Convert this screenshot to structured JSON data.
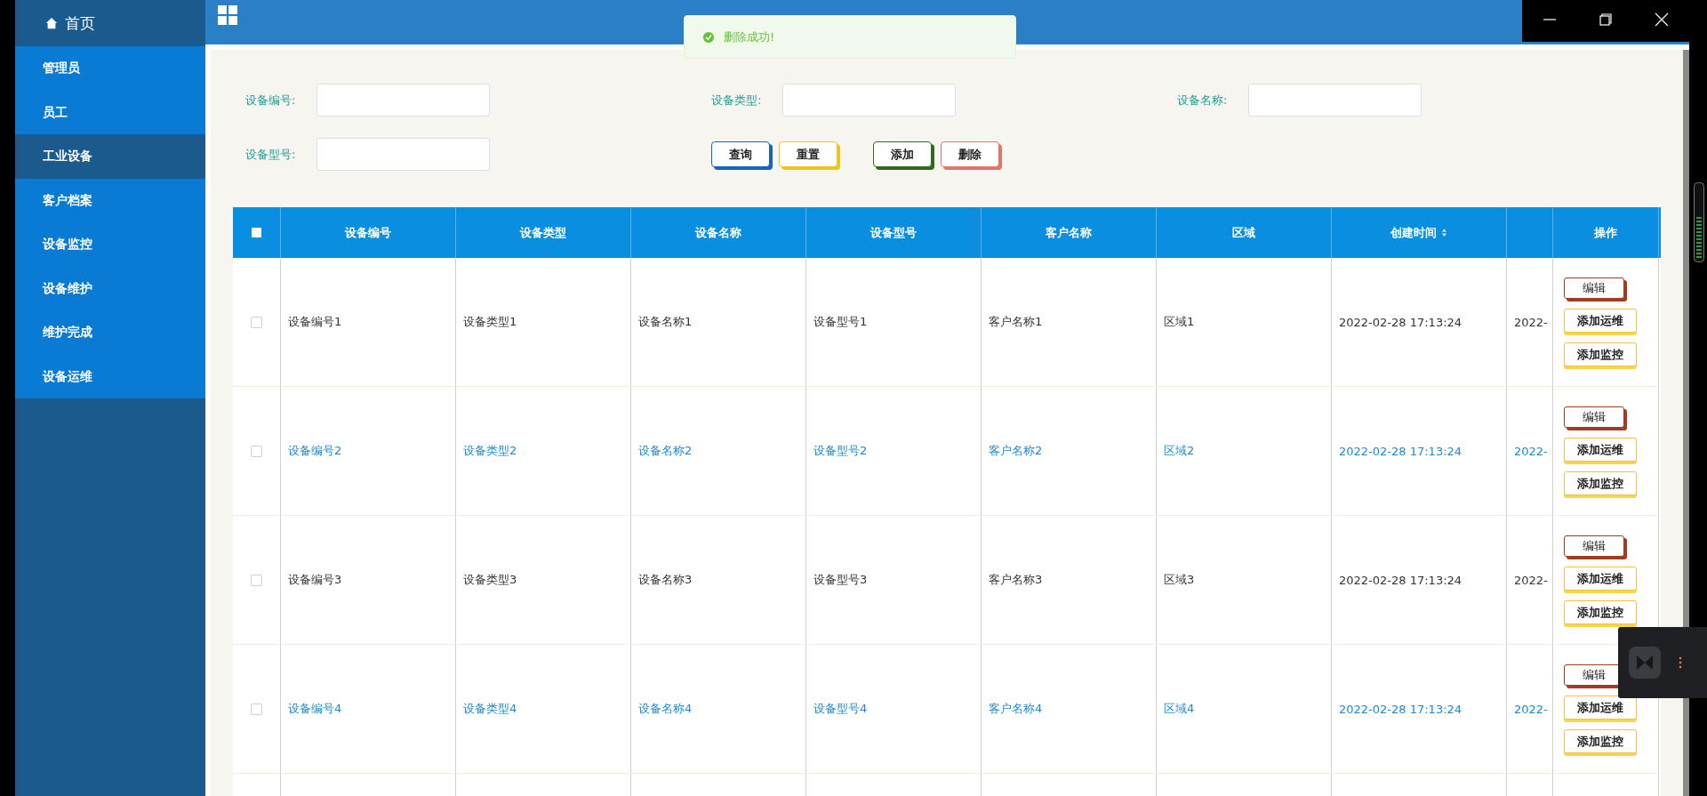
{
  "sidebar": {
    "home": "首页",
    "items": [
      {
        "label": "管理员",
        "selected": false
      },
      {
        "label": "员工",
        "selected": false
      },
      {
        "label": "工业设备",
        "selected": true
      },
      {
        "label": "客户档案",
        "selected": false
      },
      {
        "label": "设备监控",
        "selected": false
      },
      {
        "label": "设备维护",
        "selected": false
      },
      {
        "label": "维护完成",
        "selected": false
      },
      {
        "label": "设备运维",
        "selected": false
      }
    ]
  },
  "toast": {
    "message": "删除成功!"
  },
  "search_form": {
    "fields": [
      {
        "label": "设备编号:"
      },
      {
        "label": "设备类型:"
      },
      {
        "label": "设备名称:"
      },
      {
        "label": "设备型号:"
      }
    ],
    "buttons": [
      {
        "label": "查询",
        "color": "#1565c0"
      },
      {
        "label": "重置",
        "color": "#f0c419"
      },
      {
        "label": "添加",
        "color": "#2e6b1f"
      },
      {
        "label": "删除",
        "color": "#e57368"
      }
    ]
  },
  "table": {
    "select_all_checked": false,
    "columns": [
      {
        "label": "设备编号",
        "sortable": false
      },
      {
        "label": "设备类型",
        "sortable": false
      },
      {
        "label": "设备名称",
        "sortable": false
      },
      {
        "label": "设备型号",
        "sortable": false
      },
      {
        "label": "客户名称",
        "sortable": false
      },
      {
        "label": "区域",
        "sortable": false
      },
      {
        "label": "创建时间",
        "sortable": true
      },
      {
        "sortable": false
      },
      {
        "label": "操作",
        "sortable": false
      }
    ],
    "rows": [
      {
        "kind": "plain",
        "checked": false,
        "cells": [
          "设备编号1",
          "设备类型1",
          "设备名称1",
          "设备型号1",
          "客户名称1",
          "区域1",
          "2022-02-28 17:13:24",
          "2022-"
        ],
        "actions": [
          "编辑",
          "添加运维",
          "添加监控"
        ]
      },
      {
        "kind": "link",
        "checked": false,
        "cells": [
          "设备编号2",
          "设备类型2",
          "设备名称2",
          "设备型号2",
          "客户名称2",
          "区域2",
          "2022-02-28 17:13:24",
          "2022-"
        ],
        "actions": [
          "编辑",
          "添加运维",
          "添加监控"
        ]
      },
      {
        "kind": "plain",
        "checked": false,
        "cells": [
          "设备编号3",
          "设备类型3",
          "设备名称3",
          "设备型号3",
          "客户名称3",
          "区域3",
          "2022-02-28 17:13:24",
          "2022-"
        ],
        "actions": [
          "编辑",
          "添加运维",
          "添加监控"
        ]
      },
      {
        "kind": "link",
        "checked": false,
        "cells": [
          "设备编号4",
          "设备类型4",
          "设备名称4",
          "设备型号4",
          "客户名称4",
          "区域4",
          "2022-02-28 17:13:24",
          "2022-"
        ],
        "actions": [
          "编辑",
          "添加运维",
          "添加监控"
        ]
      }
    ]
  }
}
